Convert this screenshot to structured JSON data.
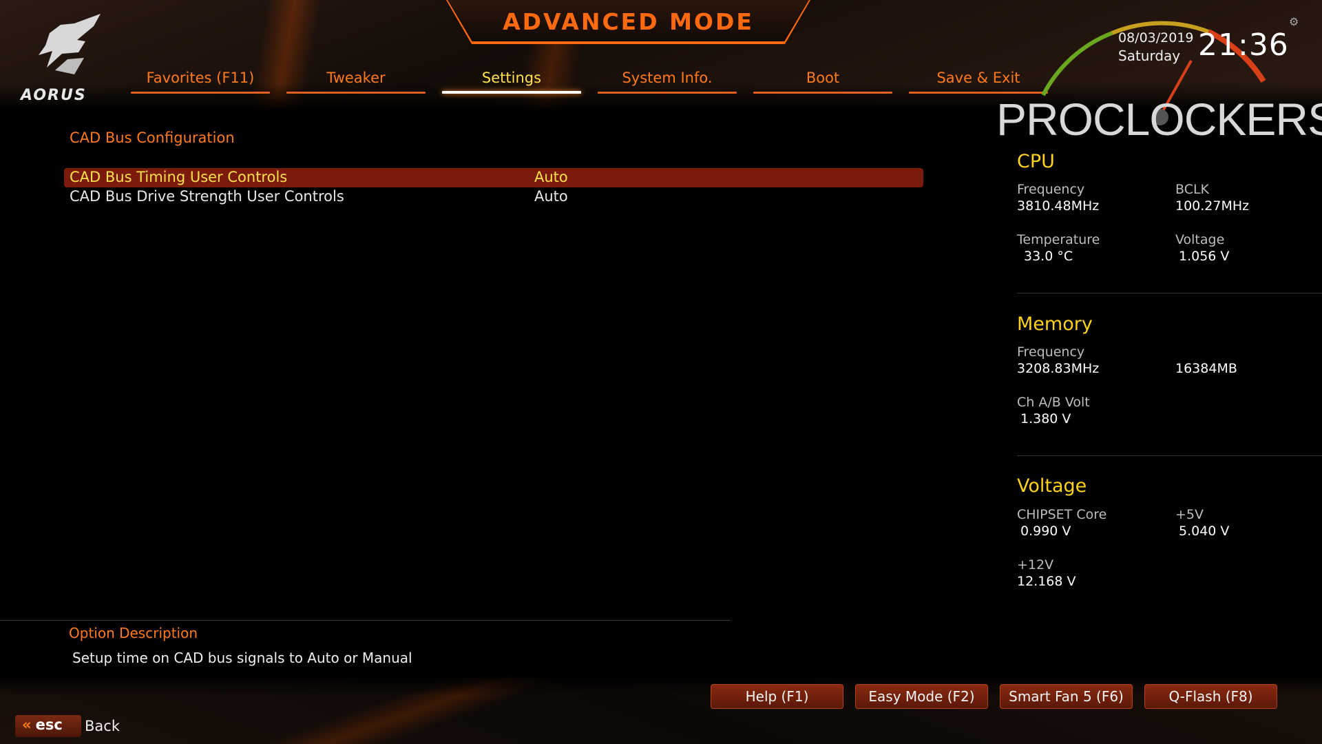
{
  "header": {
    "title": "ADVANCED MODE",
    "logo_text": "AORUS",
    "date": "08/03/2019",
    "day": "Saturday",
    "time": "21:36",
    "watermark": "PROCLOCKERS"
  },
  "tabs": [
    {
      "label": "Favorites (F11)",
      "active": false
    },
    {
      "label": "Tweaker",
      "active": false
    },
    {
      "label": "Settings",
      "active": true
    },
    {
      "label": "System Info.",
      "active": false
    },
    {
      "label": "Boot",
      "active": false
    },
    {
      "label": "Save & Exit",
      "active": false
    }
  ],
  "main": {
    "section_title": "CAD Bus Configuration",
    "rows": [
      {
        "label": "CAD Bus Timing User Controls",
        "value": "Auto",
        "selected": true
      },
      {
        "label": "CAD Bus Drive Strength User Controls",
        "value": "Auto",
        "selected": false
      }
    ]
  },
  "panel": {
    "cpu": {
      "heading": "CPU",
      "frequency_label": "Frequency",
      "frequency_value": "3810.48MHz",
      "bclk_label": "BCLK",
      "bclk_value": "100.27MHz",
      "temperature_label": "Temperature",
      "temperature_value": "33.0 °C",
      "voltage_label": "Voltage",
      "voltage_value": "1.056 V"
    },
    "memory": {
      "heading": "Memory",
      "frequency_label": "Frequency",
      "frequency_value": "3208.83MHz",
      "size_value": "16384MB",
      "volt_label": "Ch A/B Volt",
      "volt_value": "1.380 V"
    },
    "voltage": {
      "heading": "Voltage",
      "chipset_label": "CHIPSET Core",
      "chipset_value": "0.990 V",
      "v5_label": "+5V",
      "v5_value": "5.040 V",
      "v12_label": "+12V",
      "v12_value": "12.168 V"
    }
  },
  "description": {
    "title": "Option Description",
    "text": "Setup time on CAD bus signals to Auto or Manual"
  },
  "footer": {
    "buttons": [
      "Help (F1)",
      "Easy Mode (F2)",
      "Smart Fan 5 (F6)",
      "Q-Flash (F8)"
    ],
    "esc_label": "esc",
    "back_label": "Back"
  },
  "colors": {
    "accent": "#ff6a10",
    "highlight_text": "#ffe14d",
    "selected_row": "#7a1b0c",
    "panel_heading": "#ffd21a"
  }
}
